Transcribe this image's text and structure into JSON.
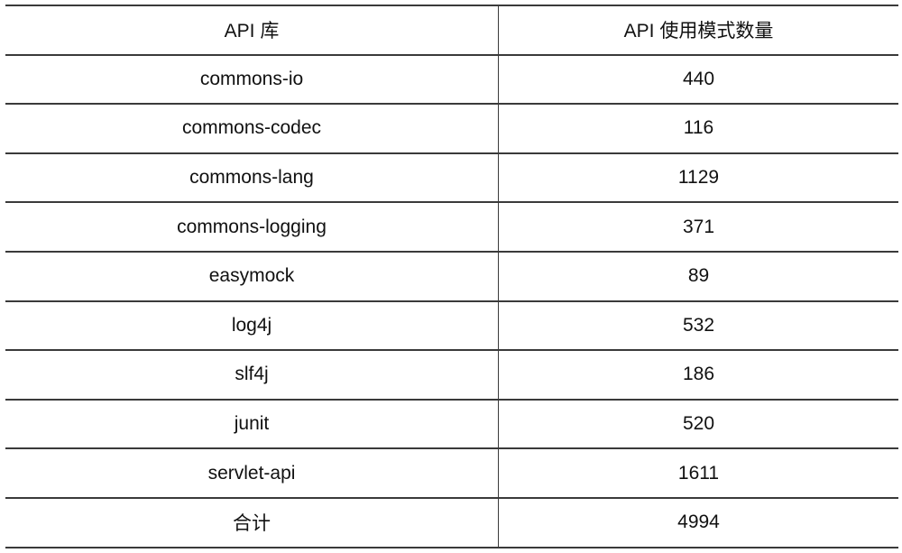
{
  "table": {
    "headers": [
      "API 库",
      "API 使用模式数量"
    ],
    "rows": [
      {
        "library": "commons-io",
        "count": "440"
      },
      {
        "library": "commons-codec",
        "count": "116"
      },
      {
        "library": "commons-lang",
        "count": "1129"
      },
      {
        "library": "commons-logging",
        "count": "371"
      },
      {
        "library": "easymock",
        "count": "89"
      },
      {
        "library": "log4j",
        "count": "532"
      },
      {
        "library": "slf4j",
        "count": "186"
      },
      {
        "library": "junit",
        "count": "520"
      },
      {
        "library": "servlet-api",
        "count": "1611"
      }
    ],
    "total": {
      "label": "合计",
      "count": "4994"
    }
  }
}
